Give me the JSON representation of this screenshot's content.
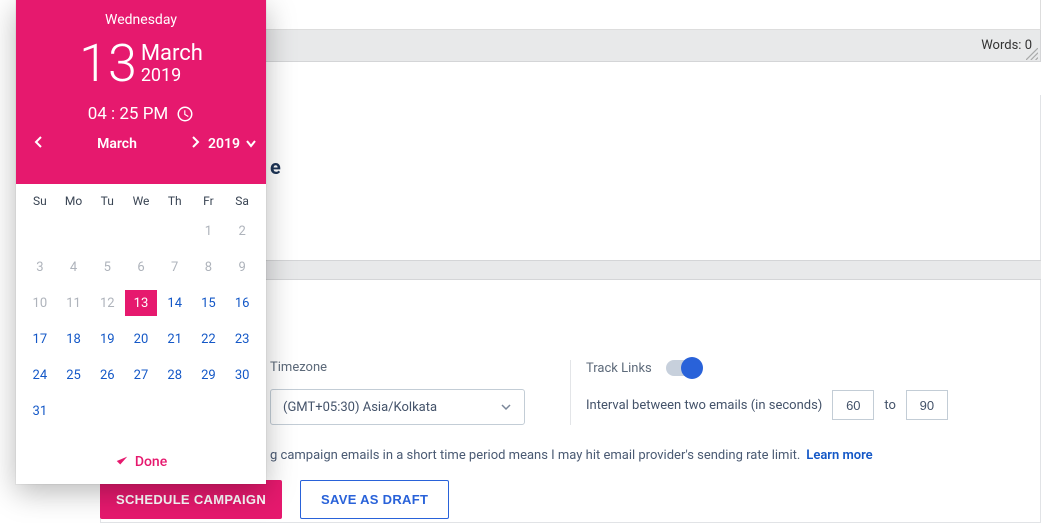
{
  "editor": {
    "words_label": "Words:",
    "words_count": 0
  },
  "heading_fragment": "e",
  "timezone": {
    "label": "Timezone",
    "selected": "(GMT+05:30) Asia/Kolkata"
  },
  "track_links": {
    "label": "Track Links",
    "on": true
  },
  "interval": {
    "label": "Interval between two emails (in seconds)",
    "from": "60",
    "to_word": "to",
    "to": "90"
  },
  "warning": {
    "text": "g campaign emails in a short time period means I may hit email provider's sending rate limit.",
    "learn": "Learn more"
  },
  "actions": {
    "primary": "SCHEDULE CAMPAIGN",
    "draft": "SAVE AS DRAFT"
  },
  "dp": {
    "weekday": "Wednesday",
    "day": "13",
    "month": "March",
    "year": "2019",
    "time": "04 : 25 PM",
    "nav_month": "March",
    "nav_year": "2019",
    "weekdays": [
      "Su",
      "Mo",
      "Tu",
      "We",
      "Th",
      "Fr",
      "Sa"
    ],
    "cells": [
      {
        "t": "",
        "c": "empty"
      },
      {
        "t": "",
        "c": "empty"
      },
      {
        "t": "",
        "c": "empty"
      },
      {
        "t": "",
        "c": "empty"
      },
      {
        "t": "",
        "c": "empty"
      },
      {
        "t": "1",
        "c": "dim"
      },
      {
        "t": "2",
        "c": "dim"
      },
      {
        "t": "3",
        "c": "dim"
      },
      {
        "t": "4",
        "c": "dim"
      },
      {
        "t": "5",
        "c": "dim"
      },
      {
        "t": "6",
        "c": "dim"
      },
      {
        "t": "7",
        "c": "dim"
      },
      {
        "t": "8",
        "c": "dim"
      },
      {
        "t": "9",
        "c": "dim"
      },
      {
        "t": "10",
        "c": "dim"
      },
      {
        "t": "11",
        "c": "dim"
      },
      {
        "t": "12",
        "c": "dim"
      },
      {
        "t": "13",
        "c": "sel"
      },
      {
        "t": "14",
        "c": ""
      },
      {
        "t": "15",
        "c": ""
      },
      {
        "t": "16",
        "c": ""
      },
      {
        "t": "17",
        "c": ""
      },
      {
        "t": "18",
        "c": ""
      },
      {
        "t": "19",
        "c": ""
      },
      {
        "t": "20",
        "c": ""
      },
      {
        "t": "21",
        "c": ""
      },
      {
        "t": "22",
        "c": ""
      },
      {
        "t": "23",
        "c": ""
      },
      {
        "t": "24",
        "c": ""
      },
      {
        "t": "25",
        "c": ""
      },
      {
        "t": "26",
        "c": ""
      },
      {
        "t": "27",
        "c": ""
      },
      {
        "t": "28",
        "c": ""
      },
      {
        "t": "29",
        "c": ""
      },
      {
        "t": "30",
        "c": ""
      },
      {
        "t": "31",
        "c": ""
      }
    ],
    "done": "Done"
  }
}
